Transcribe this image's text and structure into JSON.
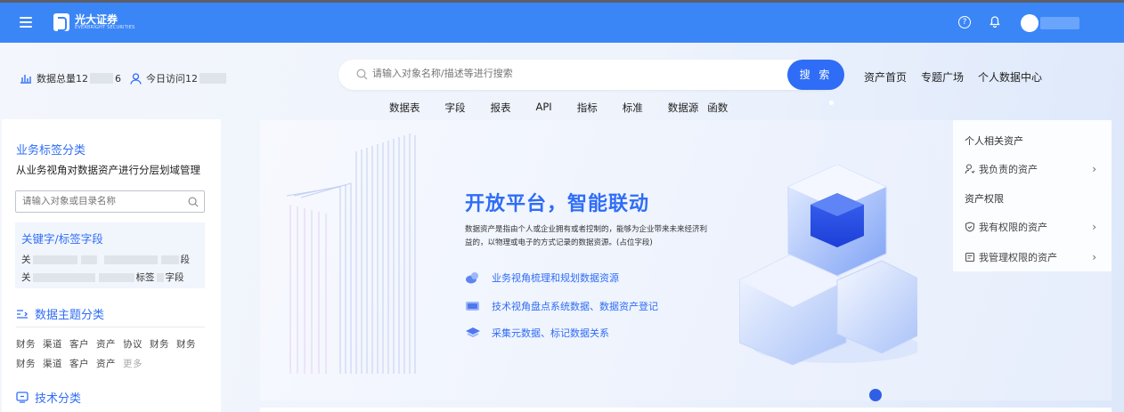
{
  "header": {
    "brand_name": "光大证券",
    "brand_sub": "EVERBRIGHT SECURITIES"
  },
  "stats": {
    "total_label": "数据总量12",
    "total_tail": "6",
    "visits_label": "今日访问12"
  },
  "search": {
    "placeholder": "请输入对象名称/描述等进行搜索",
    "button": "搜 索"
  },
  "nav": {
    "links": [
      "资产首页",
      "专题广场",
      "个人数据中心"
    ]
  },
  "categories": [
    "数据表",
    "字段",
    "报表",
    "API",
    "指标",
    "标准",
    "数据源",
    "函数"
  ],
  "sidebar": {
    "title": "业务标签分类",
    "desc": "从业务视角对数据资产进行分层划域管理",
    "search_placeholder": "请输入对象或目录名称",
    "keyword_title": "关键字/标签字段",
    "keyword_row1_start": "关",
    "keyword_row1_end": "段",
    "keyword_row2_start": "关",
    "keyword_row2_mid": "标签",
    "keyword_row2_end": "字段",
    "theme_title": "数据主题分类",
    "theme_row1": [
      "财务",
      "渠道",
      "客户",
      "资产",
      "协议",
      "财务",
      "财务"
    ],
    "theme_row2": [
      "财务",
      "渠道",
      "客户",
      "资产"
    ],
    "more": "更多",
    "tech_title": "技术分类"
  },
  "banner": {
    "title": "开放平台，智能联动",
    "desc": "数据资产是指由个人或企业拥有或者控制的，能够为企业带来未来经济利益的，以物理或电子的方式记录的数据资源。(占位字段)",
    "features": [
      "业务视角梳理和规划数据资源",
      "技术视角盘点系统数据、数据资产登记",
      "采集元数据、标记数据关系"
    ]
  },
  "right_panel": {
    "head1": "个人相关资产",
    "item1": "我负责的资产",
    "head2": "资产权限",
    "item2": "我有权限的资产",
    "item3": "我管理权限的资产"
  },
  "colors": {
    "header_bg": "#3a86f7",
    "accent": "#2f6df6"
  }
}
